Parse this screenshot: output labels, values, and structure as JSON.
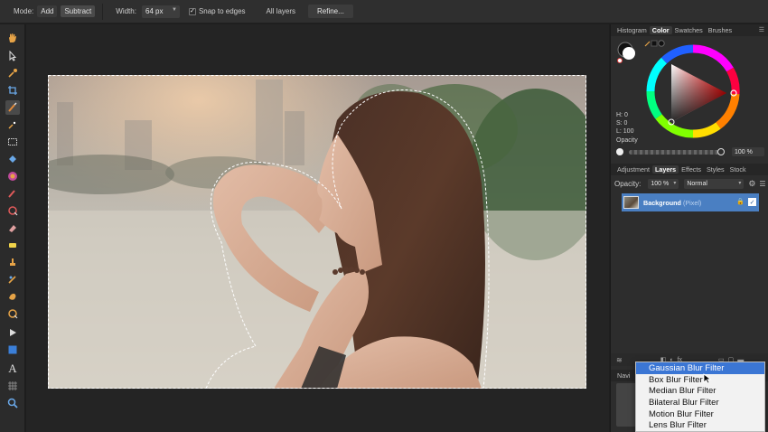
{
  "toolbar": {
    "mode_label": "Mode:",
    "add_label": "Add",
    "subtract_label": "Subtract",
    "width_label": "Width:",
    "width_value": "64 px",
    "snap_label": "Snap to edges",
    "snap_checked": true,
    "all_layers_label": "All layers",
    "all_layers_checked": false,
    "refine_label": "Refine..."
  },
  "tools": [
    "hand-icon",
    "pointer-icon",
    "color-picker-icon",
    "crop-icon",
    "selection-brush-icon",
    "flood-select-icon",
    "marquee-icon",
    "fill-icon",
    "gradient-icon",
    "paint-brush-icon",
    "pixel-icon",
    "erase-icon",
    "smudge-icon",
    "dodge-icon",
    "clone-icon",
    "patch-icon",
    "red-eye-icon",
    "pen-icon",
    "shape-icon",
    "text-icon",
    "mesh-warp-icon",
    "zoom-icon"
  ],
  "color_panel": {
    "tabs": [
      "Histogram",
      "Color",
      "Swatches",
      "Brushes"
    ],
    "active_tab": "Color",
    "h": "H: 0",
    "s": "S: 0",
    "l": "L: 100",
    "opacity_label": "Opacity",
    "opacity_value": "100 %"
  },
  "layers_panel": {
    "tabs": [
      "Adjustment",
      "Layers",
      "Effects",
      "Styles",
      "Stock"
    ],
    "active_tab": "Layers",
    "opacity_label": "Opacity:",
    "opacity_value": "100 %",
    "blend_mode": "Normal",
    "layer_name": "Background",
    "layer_type": "(Pixel)"
  },
  "navigator": {
    "tab_label": "Navi"
  },
  "blur_menu": {
    "items": [
      "Gaussian Blur Filter",
      "Box Blur Filter",
      "Median Blur Filter",
      "Bilateral Blur Filter",
      "Motion Blur Filter",
      "Lens Blur Filter"
    ],
    "highlighted_index": 0
  },
  "colors": {
    "selection_blue": "#3b76d4",
    "layer_row_blue": "#4a7fc2"
  }
}
